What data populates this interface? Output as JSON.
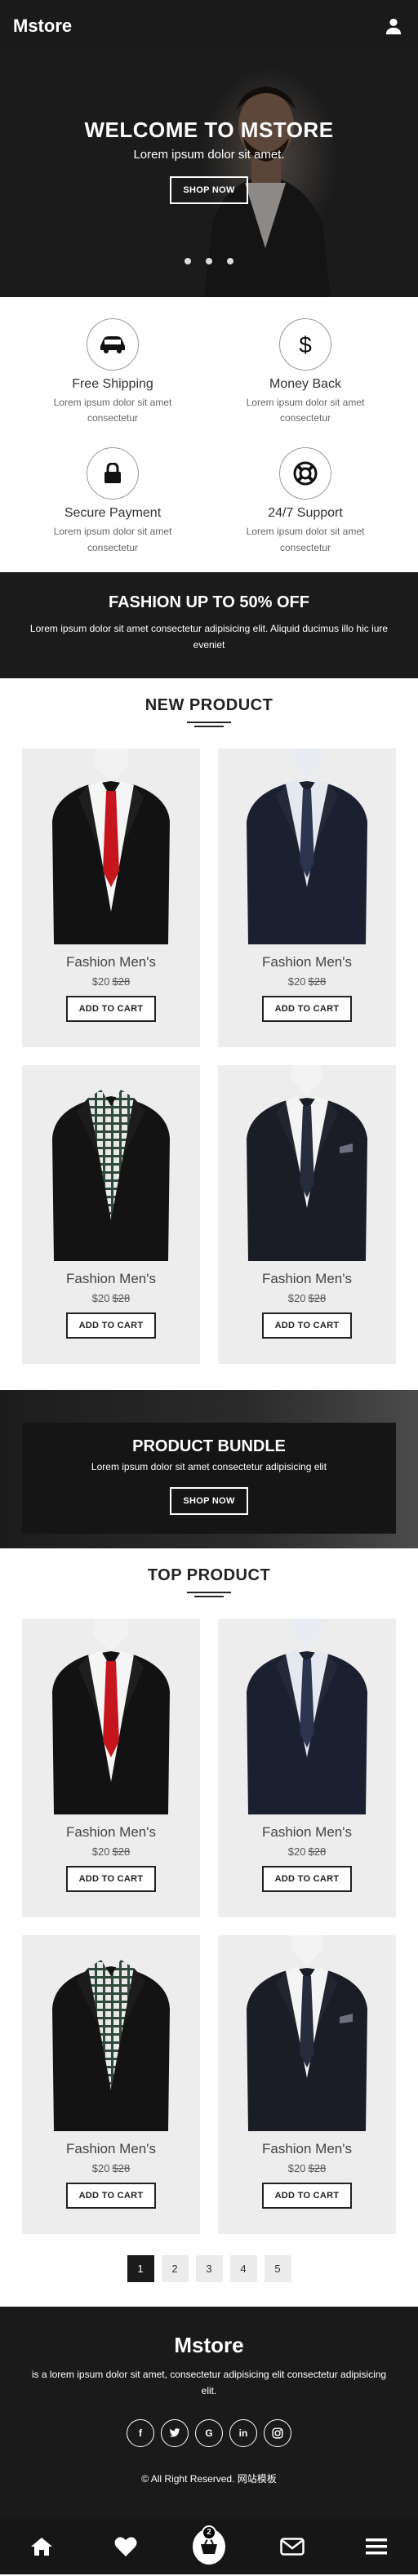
{
  "header": {
    "brand": "Mstore",
    "user_icon": "user-icon"
  },
  "hero": {
    "title": "WELCOME TO MSTORE",
    "subtitle": "Lorem ipsum dolor sit amet.",
    "button": "SHOP NOW",
    "slide_count": 3
  },
  "features": [
    {
      "icon": "truck-icon",
      "title": "Free Shipping",
      "text": "Lorem ipsum dolor sit amet consectetur"
    },
    {
      "icon": "dollar-icon",
      "title": "Money Back",
      "text": "Lorem ipsum dolor sit amet consectetur"
    },
    {
      "icon": "lock-icon",
      "title": "Secure Payment",
      "text": "Lorem ipsum dolor sit amet consectetur"
    },
    {
      "icon": "lifebuoy-icon",
      "title": "24/7 Support",
      "text": "Lorem ipsum dolor sit amet consectetur"
    }
  ],
  "promo": {
    "title": "FASHION UP TO 50% OFF",
    "text": "Lorem ipsum dolor sit amet consectetur adipisicing elit. Aliquid ducimus illo hic iure eveniet"
  },
  "new_product": {
    "title": "NEW PRODUCT",
    "items": [
      {
        "name": "Fashion Men's",
        "price": "$20",
        "old_price": "$28",
        "button": "ADD TO CART",
        "image": "suit-red-tie"
      },
      {
        "name": "Fashion Men's",
        "price": "$20",
        "old_price": "$28",
        "button": "ADD TO CART",
        "image": "suit-navy-tie"
      },
      {
        "name": "Fashion Men's",
        "price": "$20",
        "old_price": "$28",
        "button": "ADD TO CART",
        "image": "suit-plaid-shirt"
      },
      {
        "name": "Fashion Men's",
        "price": "$20",
        "old_price": "$28",
        "button": "ADD TO CART",
        "image": "suit-dark-tie"
      }
    ]
  },
  "bundle": {
    "title": "PRODUCT BUNDLE",
    "subtitle": "Lorem ipsum dolor sit amet consectetur adipisicing elit",
    "button": "SHOP NOW"
  },
  "top_product": {
    "title": "TOP PRODUCT",
    "items": [
      {
        "name": "Fashion Men's",
        "price": "$20",
        "old_price": "$28",
        "button": "ADD TO CART",
        "image": "suit-red-tie"
      },
      {
        "name": "Fashion Men's",
        "price": "$20",
        "old_price": "$28",
        "button": "ADD TO CART",
        "image": "suit-navy-tie"
      },
      {
        "name": "Fashion Men's",
        "price": "$20",
        "old_price": "$28",
        "button": "ADD TO CART",
        "image": "suit-plaid-shirt"
      },
      {
        "name": "Fashion Men's",
        "price": "$20",
        "old_price": "$28",
        "button": "ADD TO CART",
        "image": "suit-dark-tie"
      }
    ]
  },
  "pagination": {
    "pages": [
      "1",
      "2",
      "3",
      "4",
      "5"
    ],
    "active": "1"
  },
  "footer": {
    "brand": "Mstore",
    "text": "is a lorem ipsum dolor sit amet, consectetur adipisicing elit consectetur adipisicing elit.",
    "socials": [
      {
        "label": "f",
        "icon": "facebook-icon"
      },
      {
        "label": "t",
        "icon": "twitter-icon"
      },
      {
        "label": "G",
        "icon": "google-icon"
      },
      {
        "label": "in",
        "icon": "linkedin-icon"
      },
      {
        "label": "◎",
        "icon": "instagram-icon"
      }
    ],
    "copyright": "© All Right Reserved. 网站模板"
  },
  "bottom_nav": {
    "items": [
      "home-icon",
      "heart-icon",
      "shopping-basket-icon",
      "mail-icon",
      "menu-icon"
    ],
    "cart_count": "2"
  },
  "colors": {
    "dark": "#1a1a1a",
    "card_bg": "#ededed",
    "tie_red": "#c4161c"
  }
}
